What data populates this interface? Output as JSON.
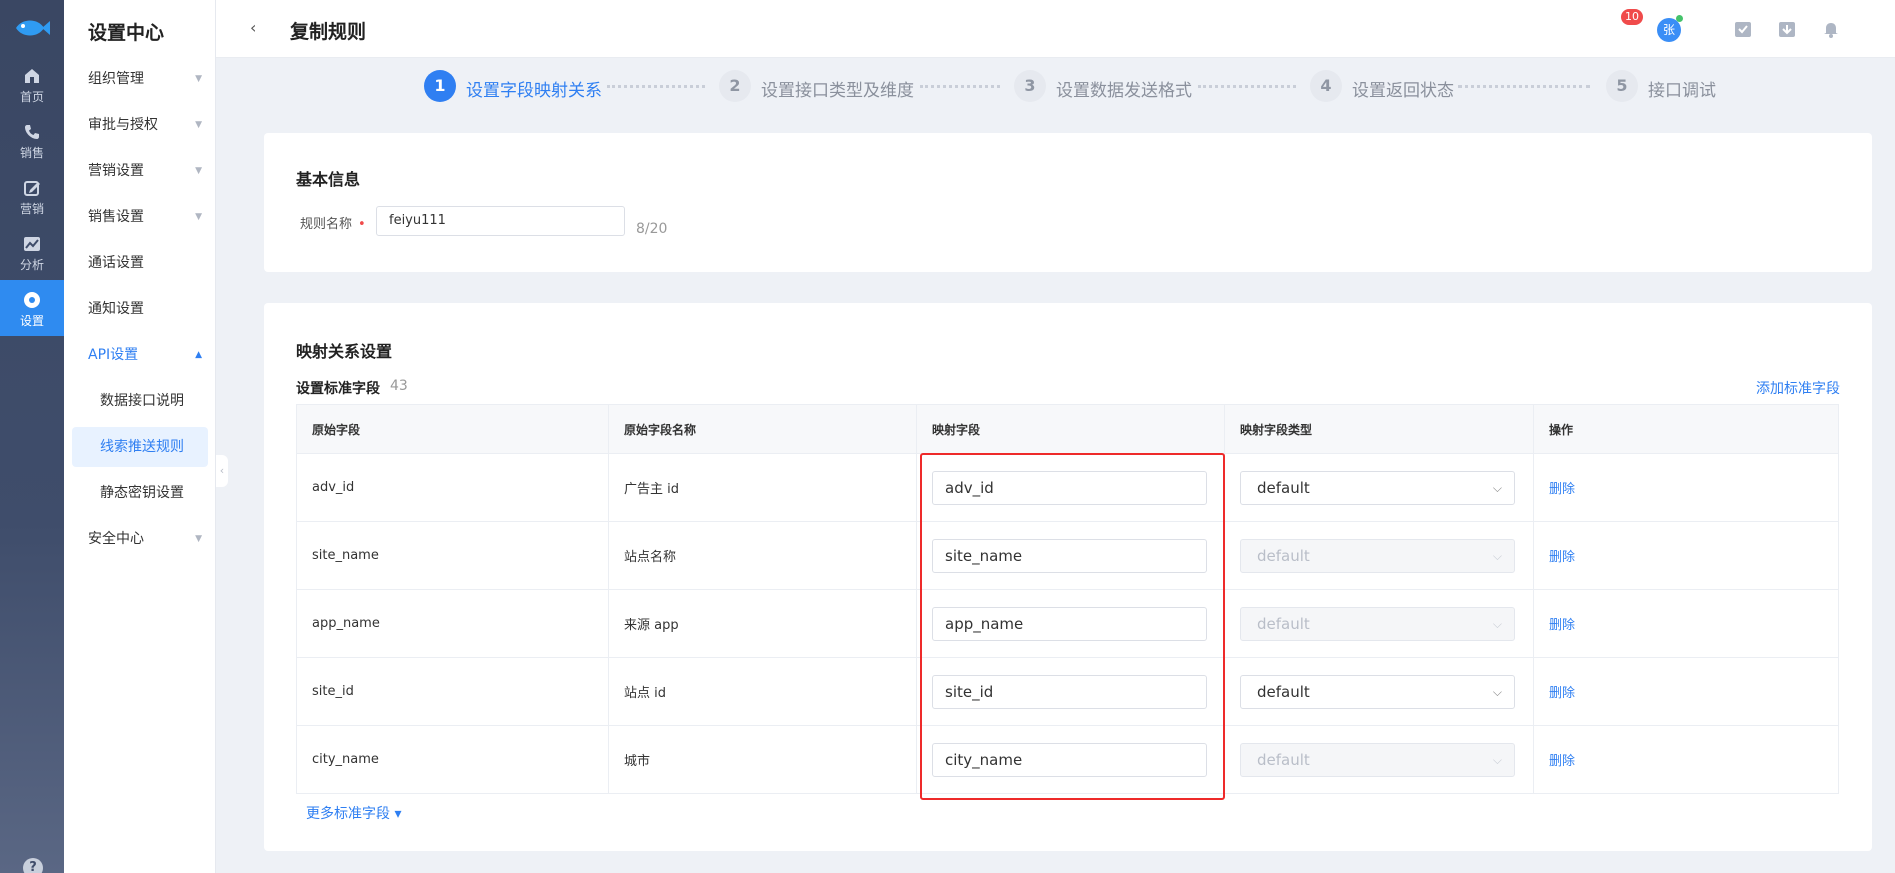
{
  "rail": {
    "items": [
      {
        "label": "首页",
        "icon": "home-icon"
      },
      {
        "label": "销售",
        "icon": "phone-icon"
      },
      {
        "label": "营销",
        "icon": "edit-icon"
      },
      {
        "label": "分析",
        "icon": "chart-icon"
      },
      {
        "label": "设置",
        "icon": "settings-icon",
        "active": true
      }
    ],
    "help": "?"
  },
  "sidebar": {
    "title": "设置中心",
    "items": [
      {
        "label": "组织管理"
      },
      {
        "label": "审批与授权"
      },
      {
        "label": "营销设置"
      },
      {
        "label": "销售设置"
      },
      {
        "label": "通话设置"
      },
      {
        "label": "通知设置"
      },
      {
        "label": "API设置"
      },
      {
        "label": "数据接口说明"
      },
      {
        "label": "线索推送规则"
      },
      {
        "label": "静态密钥设置"
      },
      {
        "label": "安全中心"
      }
    ]
  },
  "header": {
    "title": "复制规则",
    "notification_count": "10",
    "avatar": "张"
  },
  "steps": [
    {
      "num": "1",
      "label": "设置字段映射关系"
    },
    {
      "num": "2",
      "label": "设置接口类型及维度"
    },
    {
      "num": "3",
      "label": "设置数据发送格式"
    },
    {
      "num": "4",
      "label": "设置返回状态"
    },
    {
      "num": "5",
      "label": "接口调试"
    }
  ],
  "basic": {
    "title": "基本信息",
    "name_label": "规则名称",
    "required_mark": "•",
    "name_value": "feiyu111",
    "name_count": "8/20"
  },
  "mapping": {
    "title": "映射关系设置",
    "subtitle": "设置标准字段",
    "count": "43",
    "add_link": "添加标准字段",
    "more_link": "更多标准字段",
    "columns": [
      "原始字段",
      "原始字段名称",
      "映射字段",
      "映射字段类型",
      "操作"
    ],
    "rows": [
      {
        "field": "adv_id",
        "name": "广告主 id",
        "map": "adv_id",
        "type": "default",
        "op": "删除"
      },
      {
        "field": "site_name",
        "name": "站点名称",
        "map": "site_name",
        "type": "default",
        "op": "删除"
      },
      {
        "field": "app_name",
        "name": "来源 app",
        "map": "app_name",
        "type": "default",
        "op": "删除"
      },
      {
        "field": "site_id",
        "name": "站点 id",
        "map": "site_id",
        "type": "default",
        "op": "删除"
      },
      {
        "field": "city_name",
        "name": "城市",
        "map": "city_name",
        "type": "default",
        "op": "删除"
      }
    ]
  }
}
